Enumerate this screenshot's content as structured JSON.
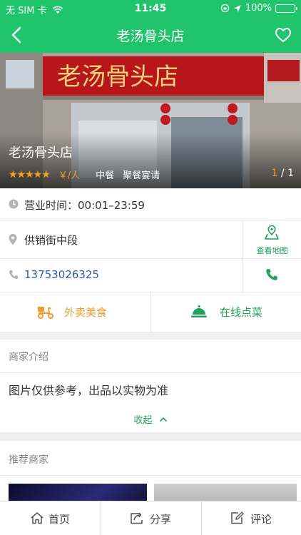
{
  "status_bar": {
    "carrier": "无 SIM 卡",
    "time": "11:45",
    "battery": "100%",
    "battery_level": 1.0
  },
  "nav": {
    "title": "老汤骨头店"
  },
  "hero": {
    "name": "老汤骨头店",
    "rating_stars": 5,
    "price": "￥/人",
    "category": "中餐",
    "tag": "聚餐宴请",
    "photo_current": "1",
    "photo_total": "/ 1",
    "sign_text": "老汤骨头店"
  },
  "info": {
    "hours": "营业时间：00:01–23:59",
    "address": "供销街中段",
    "map_label": "查看地图",
    "phone": "13753026325"
  },
  "actions": {
    "takeout": "外卖美食",
    "order_online": "在线点菜"
  },
  "intro": {
    "heading": "商家介绍",
    "text": "图片仅供参考，出品以实物为准",
    "collapse": "收起"
  },
  "recommend": {
    "heading": "推荐商家"
  },
  "tabbar": {
    "home": "首页",
    "share": "分享",
    "review": "评论"
  },
  "colors": {
    "brand_green": "#1fc46b",
    "accent_orange": "#f39a2b",
    "link_blue": "#2a5db0"
  },
  "icons": [
    "wifi-icon",
    "location-arrow-icon",
    "back-arrow-icon",
    "heart-icon",
    "clock-icon",
    "map-pin-icon",
    "map-icon",
    "phone-icon",
    "delivery-scooter-icon",
    "serving-bell-icon",
    "chevron-up-icon",
    "home-icon",
    "share-icon",
    "edit-icon"
  ]
}
